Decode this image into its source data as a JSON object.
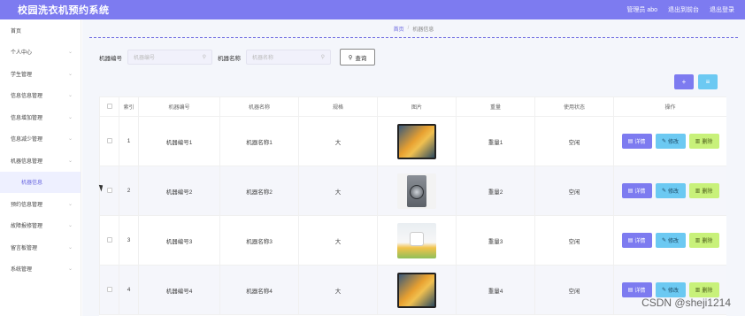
{
  "header": {
    "title": "校园洗衣机预约系统",
    "admin": "管理员 abo",
    "back": "退出到前台",
    "logout": "退出登录"
  },
  "sidebar": {
    "items": [
      {
        "label": "首页",
        "chevron": false,
        "sub": false
      },
      {
        "label": "个人中心",
        "chevron": true,
        "sub": false
      },
      {
        "label": "学生管理",
        "chevron": true,
        "sub": false
      },
      {
        "label": "信息信息管理",
        "chevron": true,
        "sub": false
      },
      {
        "label": "信息增加管理",
        "chevron": true,
        "sub": false
      },
      {
        "label": "信息减少管理",
        "chevron": true,
        "sub": false
      },
      {
        "label": "机器信息管理",
        "chevron": true,
        "sub": false
      },
      {
        "label": "机器信息",
        "chevron": false,
        "sub": true
      },
      {
        "label": "预约信息管理",
        "chevron": true,
        "sub": false
      },
      {
        "label": "故障报修管理",
        "chevron": true,
        "sub": false
      },
      {
        "label": "留言板管理",
        "chevron": true,
        "sub": false
      },
      {
        "label": "系统管理",
        "chevron": true,
        "sub": false
      }
    ]
  },
  "breadcrumb": {
    "home": "首页",
    "sep": "/",
    "current": "机器信息"
  },
  "search": {
    "field1_label": "机器编号",
    "field1_placeholder": "机器编号",
    "field2_label": "机器名称",
    "field2_placeholder": "机器名称",
    "query_label": "查询"
  },
  "actions": {
    "add_icon": "+",
    "delete_icon": "≡"
  },
  "table": {
    "headers": [
      "",
      "索引",
      "机器编号",
      "机器名称",
      "规格",
      "图片",
      "重量",
      "使用状态",
      "操作"
    ],
    "rows": [
      {
        "index": "1",
        "code": "机器编号1",
        "name": "机器名称1",
        "spec": "大",
        "image": "tv",
        "weight": "重量1",
        "status": "空闲"
      },
      {
        "index": "2",
        "code": "机器编号2",
        "name": "机器名称2",
        "spec": "大",
        "image": "washer",
        "weight": "重量2",
        "status": "空闲"
      },
      {
        "index": "3",
        "code": "机器编号3",
        "name": "机器名称3",
        "spec": "大",
        "image": "kitchen",
        "weight": "重量3",
        "status": "空闲"
      },
      {
        "index": "4",
        "code": "机器编号4",
        "name": "机器名称4",
        "spec": "大",
        "image": "tv",
        "weight": "重量4",
        "status": "空闲"
      }
    ],
    "ops": {
      "detail": "详情",
      "edit": "修改",
      "delete": "删除"
    }
  },
  "colors": {
    "accent": "#7d7bf0",
    "info": "#6cc9f2",
    "success": "#c8f17a"
  },
  "watermark": "CSDN @sheji1214"
}
